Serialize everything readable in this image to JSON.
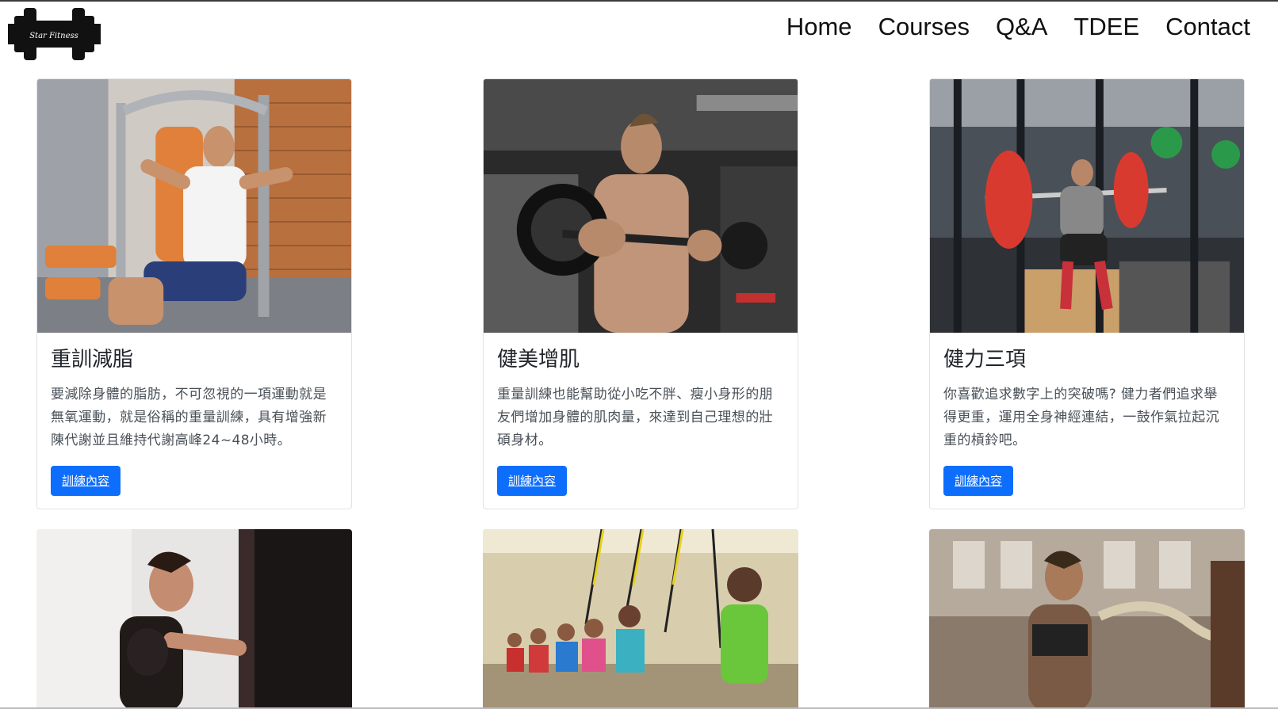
{
  "brand": {
    "logo_text": "Star Fitness"
  },
  "nav": {
    "items": [
      "Home",
      "Courses",
      "Q&A",
      "TDEE",
      "Contact"
    ]
  },
  "cards": [
    {
      "title": "重訓減脂",
      "text": "要減除身體的脂肪，不可忽視的一項運動就是無氧運動，就是俗稱的重量訓練，具有增強新陳代謝並且維持代謝高峰24~48小時。",
      "button": "訓練內容",
      "image": "man-on-chest-press-machine"
    },
    {
      "title": "健美增肌",
      "text": "重量訓練也能幫助從小吃不胖、瘦小身形的朋友們增加身體的肌肉量，來達到自己理想的壯碩身材。",
      "button": "訓練內容",
      "image": "man-doing-barbell-curl"
    },
    {
      "title": "健力三項",
      "text": "你喜歡追求數字上的突破嗎? 健力者們追求舉得更重，運用全身神經連結，一鼓作氣拉起沉重的槓鈴吧。",
      "button": "訓練內容",
      "image": "man-doing-barbell-squat"
    }
  ],
  "bottom_images": [
    "woman-boxing-punching-bag",
    "group-suspension-training-class",
    "woman-battle-ropes"
  ]
}
